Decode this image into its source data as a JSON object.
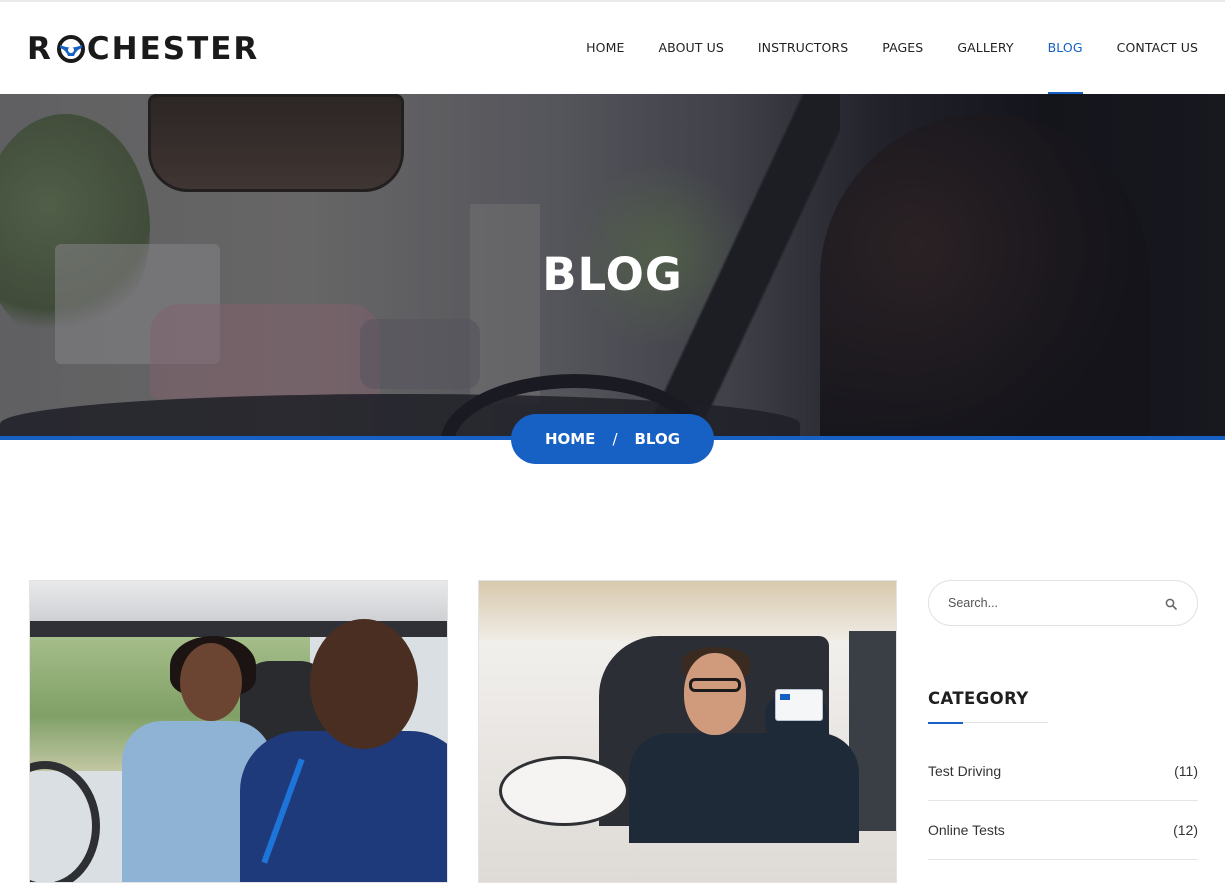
{
  "brand": {
    "logo_prefix": "R",
    "logo_suffix": "CHESTER",
    "accent": "#1760c4"
  },
  "nav": {
    "items": [
      {
        "label": "HOME",
        "active": false
      },
      {
        "label": "ABOUT US",
        "active": false
      },
      {
        "label": "INSTRUCTORS",
        "active": false
      },
      {
        "label": "PAGES",
        "active": false
      },
      {
        "label": "GALLERY",
        "active": false
      },
      {
        "label": "BLOG",
        "active": true
      },
      {
        "label": "CONTACT US",
        "active": false
      }
    ]
  },
  "hero": {
    "title": "BLOG",
    "breadcrumb": {
      "home": "HOME",
      "separator": "/",
      "current": "BLOG"
    }
  },
  "posts": [
    {
      "image": "driving-student-with-instructor"
    },
    {
      "image": "man-showing-driving-license"
    }
  ],
  "sidebar": {
    "search": {
      "placeholder": "Search...",
      "icon": "search-icon"
    },
    "category": {
      "title": "CATEGORY",
      "items": [
        {
          "label": "Test Driving",
          "count": "(11)"
        },
        {
          "label": "Online Tests",
          "count": "(12)"
        }
      ]
    }
  }
}
